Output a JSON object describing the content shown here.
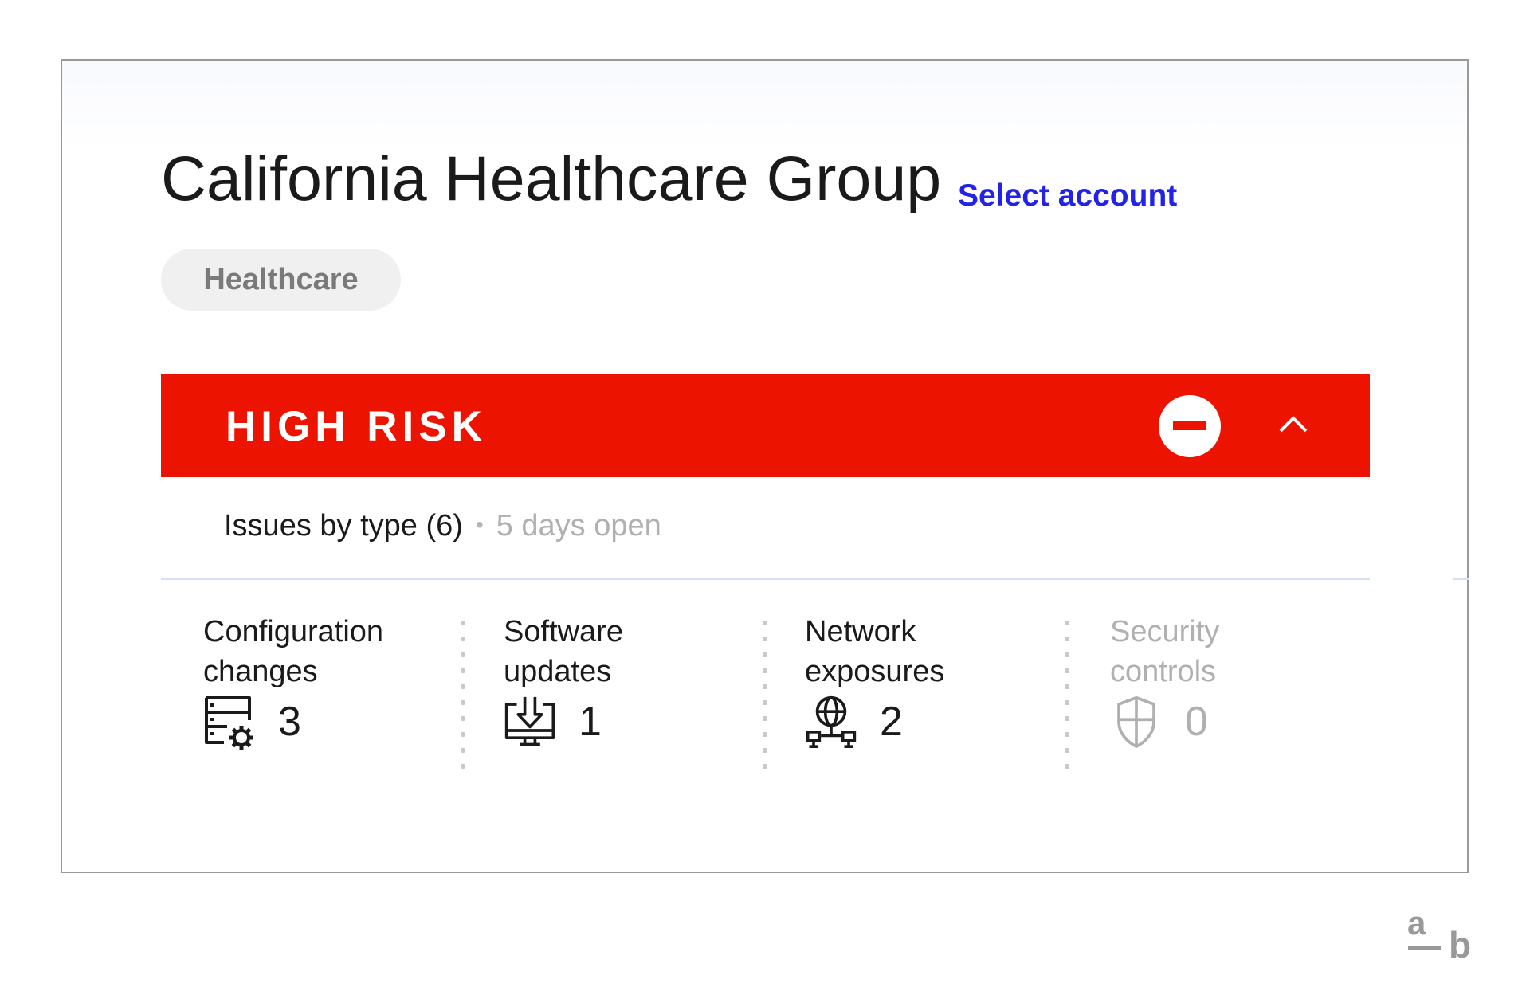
{
  "account": {
    "name": "California Healthcare Group",
    "select_account_label": "Select account",
    "industry_tag": "Healthcare"
  },
  "risk": {
    "label": "HIGH RISK",
    "status_icon": "minus-circle-icon",
    "toggle_icon": "chevron-up-icon",
    "color": "#ec1300"
  },
  "issues": {
    "summary": "Issues by type (6)",
    "separator": "•",
    "open_duration": "5 days open",
    "types": [
      {
        "label": "Configuration\nchanges",
        "icon": "server-gear-icon",
        "count": "3",
        "disabled": false
      },
      {
        "label": "Software\nupdates",
        "icon": "monitor-download-icon",
        "count": "1",
        "disabled": false
      },
      {
        "label": "Network\nexposures",
        "icon": "globe-network-icon",
        "count": "2",
        "disabled": false
      },
      {
        "label": "Security\ncontrols",
        "icon": "shield-icon",
        "count": "0",
        "disabled": true
      }
    ]
  },
  "branding": {
    "logo_top": "a",
    "logo_bottom": "b"
  },
  "colors": {
    "link": "#2323e8",
    "chip_bg": "#f0f0f0",
    "divider": "#d3defd",
    "muted": "#b0b0b0"
  }
}
